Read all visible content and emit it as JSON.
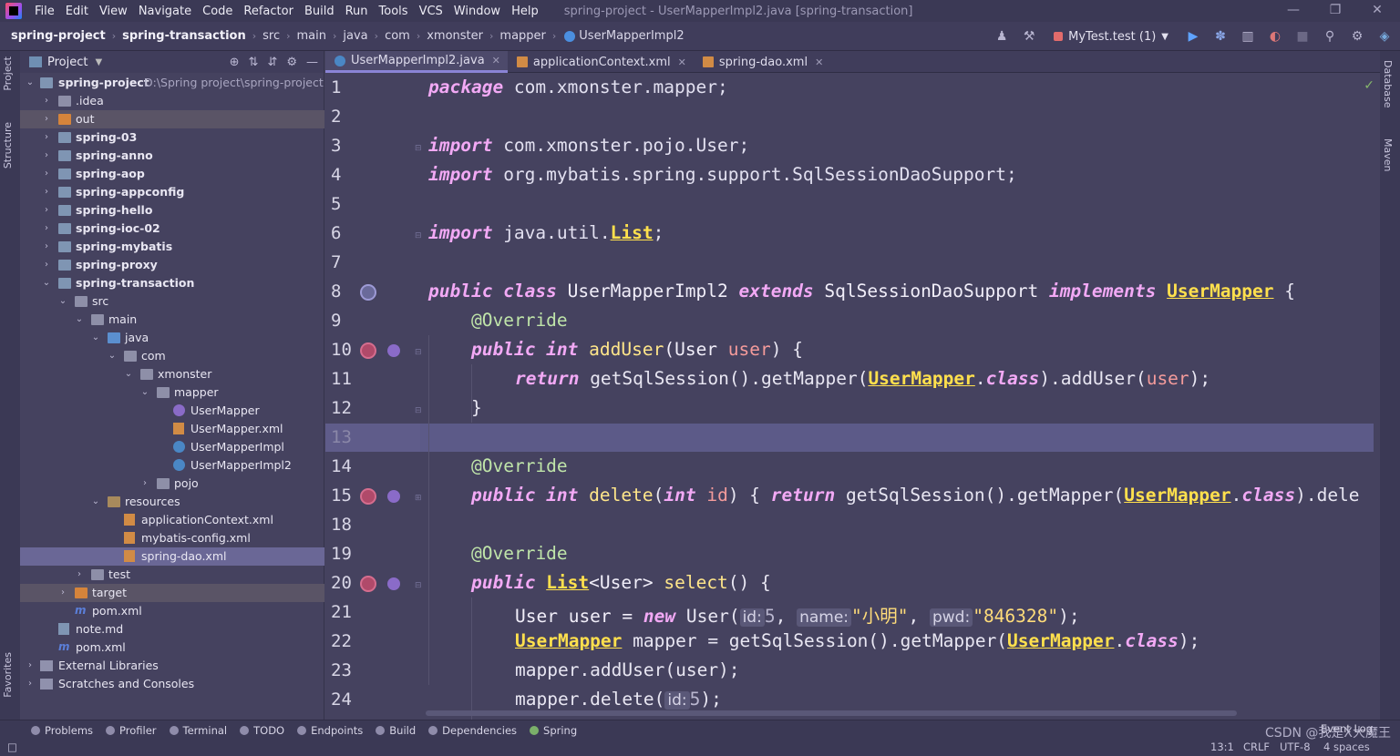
{
  "menubar": {
    "items": [
      "File",
      "Edit",
      "View",
      "Navigate",
      "Code",
      "Refactor",
      "Build",
      "Run",
      "Tools",
      "VCS",
      "Window",
      "Help"
    ],
    "title": "spring-project - UserMapperImpl2.java [spring-transaction]"
  },
  "breadcrumbs": [
    "spring-project",
    "spring-transaction",
    "src",
    "main",
    "java",
    "com",
    "xmonster",
    "mapper",
    "UserMapperImpl2"
  ],
  "run_config": "MyTest.test (1)",
  "project_panel": {
    "title": "Project",
    "tree": [
      {
        "label": "spring-project",
        "extra": "D:\\Spring project\\spring-project"
      },
      {
        "label": ".idea"
      },
      {
        "label": "out"
      },
      {
        "label": "spring-03"
      },
      {
        "label": "spring-anno"
      },
      {
        "label": "spring-aop"
      },
      {
        "label": "spring-appconfig"
      },
      {
        "label": "spring-hello"
      },
      {
        "label": "spring-ioc-02"
      },
      {
        "label": "spring-mybatis"
      },
      {
        "label": "spring-proxy"
      },
      {
        "label": "spring-transaction"
      },
      {
        "label": "src"
      },
      {
        "label": "main"
      },
      {
        "label": "java"
      },
      {
        "label": "com"
      },
      {
        "label": "xmonster"
      },
      {
        "label": "mapper"
      },
      {
        "label": "UserMapper"
      },
      {
        "label": "UserMapper.xml"
      },
      {
        "label": "UserMapperImpl"
      },
      {
        "label": "UserMapperImpl2"
      },
      {
        "label": "pojo"
      },
      {
        "label": "resources"
      },
      {
        "label": "applicationContext.xml"
      },
      {
        "label": "mybatis-config.xml"
      },
      {
        "label": "spring-dao.xml"
      },
      {
        "label": "test"
      },
      {
        "label": "target"
      },
      {
        "label": "pom.xml"
      },
      {
        "label": "note.md"
      },
      {
        "label": "pom.xml"
      },
      {
        "label": "External Libraries"
      },
      {
        "label": "Scratches and Consoles"
      }
    ]
  },
  "tabs": [
    "UserMapperImpl2.java",
    "applicationContext.xml",
    "spring-dao.xml"
  ],
  "editor": {
    "line_numbers": [
      "1",
      "2",
      "3",
      "4",
      "5",
      "6",
      "7",
      "8",
      "9",
      "10",
      "11",
      "12",
      "13",
      "14",
      "15",
      "18",
      "19",
      "20",
      "21",
      "22",
      "23",
      "24"
    ],
    "code": {
      "l1_kw": "package",
      "l1_rest": " com.xmonster.mapper;",
      "l3_kw": "import",
      "l3_rest": " com.xmonster.pojo.User;",
      "l4_kw": "import",
      "l4_rest": " org.mybatis.spring.support.SqlSessionDaoSupport;",
      "l6_kw": "import",
      "l6_a": " java.util.",
      "l6_u": "List",
      "l6_b": ";",
      "l8_k1": "public class",
      "l8_a": " UserMapperImpl2 ",
      "l8_k2": "extends",
      "l8_b": " SqlSessionDaoSupport ",
      "l8_k3": "implements",
      "l8_u": "UserMapper",
      "l8_c": " {",
      "l9": "@Override",
      "l10_k": "public int",
      "l10_fn": "addUser",
      "l10_a": "(User ",
      "l10_p": "user",
      "l10_b": ") {",
      "l11_k": "return",
      "l11_a": " getSqlSession().getMapper(",
      "l11_u": "UserMapper",
      "l11_b": ".",
      "l11_k2": "class",
      "l11_c": ").addUser(",
      "l11_p": "user",
      "l11_d": ");",
      "l12": "}",
      "l14": "@Override",
      "l15_k": "public int",
      "l15_fn": "delete",
      "l15_a": "(",
      "l15_k2": "int",
      "l15_p": "id",
      "l15_b": ") { ",
      "l15_k3": "return",
      "l15_c": " getSqlSession().getMapper(",
      "l15_u": "UserMapper",
      "l15_d": ".",
      "l15_k4": "class",
      "l15_e": ").dele",
      "l19": "@Override",
      "l20_k": "public",
      "l20_u": "List",
      "l20_a": "<User> ",
      "l20_fn": "select",
      "l20_b": "() {",
      "l21_a": "User user = ",
      "l21_k": "new",
      "l21_b": " User(",
      "l21_h1": "id:",
      "l21_v1": "5",
      "l21_c": ", ",
      "l21_h2": "name:",
      "l21_v2": "\"小明\"",
      "l21_d": ", ",
      "l21_h3": "pwd:",
      "l21_v3": "\"846328\"",
      "l21_e": ");",
      "l22_u1": "UserMapper",
      "l22_a": " mapper = getSqlSession().getMapper(",
      "l22_u2": "UserMapper",
      "l22_b": ".",
      "l22_k": "class",
      "l22_c": ");",
      "l23": "mapper.addUser(user);",
      "l24_a": "mapper.delete(",
      "l24_h": "id:",
      "l24_v": "5",
      "l24_b": ");"
    }
  },
  "right_stripe": [
    "Database",
    "Maven"
  ],
  "left_stripe": [
    "Project",
    "Structure",
    "Favorites"
  ],
  "bottom_tools": [
    "Problems",
    "Profiler",
    "Terminal",
    "TODO",
    "Endpoints",
    "Build",
    "Dependencies",
    "Spring"
  ],
  "event_log": "Event Log",
  "status": {
    "position": "13:1",
    "line_sep": "CRLF",
    "encoding": "UTF-8",
    "indent": "4 spaces"
  },
  "watermark": "CSDN @我是X大魔王"
}
